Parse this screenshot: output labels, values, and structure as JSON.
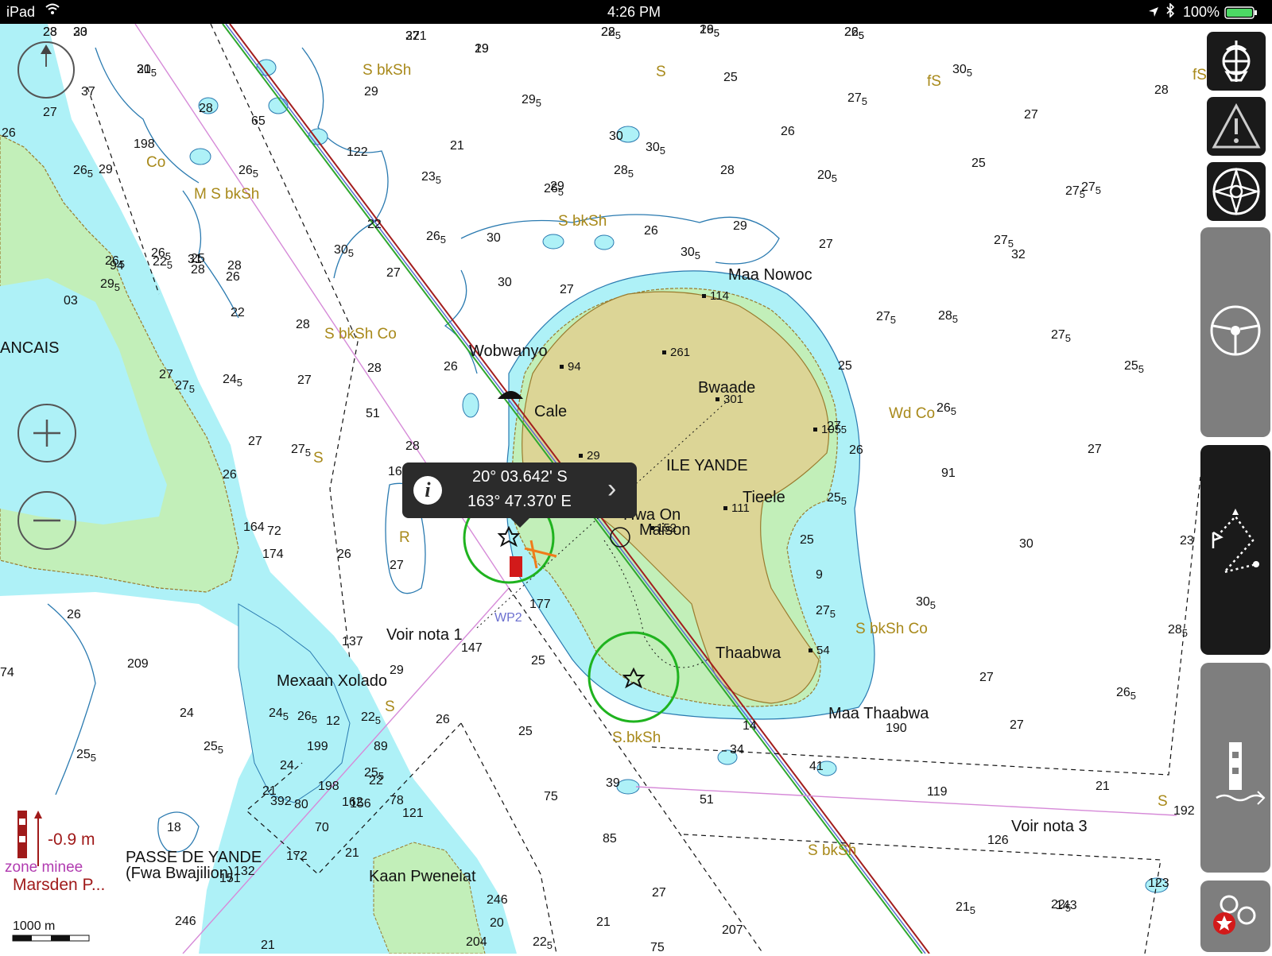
{
  "status_bar": {
    "device": "iPad",
    "time": "4:26 PM",
    "battery": "100%"
  },
  "colors": {
    "land": "#dcd596",
    "intertidal": "#c2efb9",
    "shallow": "#aef1f7",
    "deep": "#ffffff",
    "route_green": "#2ea82e",
    "route_red": "#a31d1d",
    "route_blue": "#5a6fd0",
    "seabed_text": "#a8891a"
  },
  "popup": {
    "latitude": "20° 03.642' S",
    "longitude": "163° 47.370' E"
  },
  "scale_label": "1000 m",
  "tide": {
    "value": "-0.9 m",
    "area": "zone minee",
    "station": "Marsden P..."
  },
  "place_names": {
    "ile_yande": "ILE YANDE",
    "bwaade": "Bwaade",
    "maa_nowoc": "Maa Nowoc",
    "wobwanyo": "Wobwanyo",
    "cale": "Cale",
    "hwa_on": "Hwa On",
    "maison": "Maison",
    "tieele": "Tieele",
    "thaabwa": "Thaabwa",
    "maa_thaabwa": "Maa Thaabwa",
    "mexaan": "Mexaan Xolado",
    "passe": "PASSE DE YANDE",
    "passe_sub": "(Fwa Bwajilion)",
    "kaan": "Kaan Pweneiat",
    "ancais": "ANCAIS",
    "voir1": "Voir nota 1",
    "voir3": "Voir nota 3",
    "wp2": "WP2"
  },
  "spot_heights": [
    "114",
    "261",
    "94",
    "301",
    "105",
    "29",
    "111",
    "152",
    "54"
  ],
  "seabed_labels": [
    "S bkSh",
    "S",
    "fS",
    "fS",
    "Co",
    "M S bkSh",
    "S bkSh",
    "S bkSh Co",
    "S",
    "Wd Co",
    "R",
    "S bkSh Co",
    "S",
    "S.bkSh",
    "S bkSh",
    "S"
  ],
  "soundings": [
    "28",
    "30",
    "27",
    "29",
    "285",
    "265",
    "265",
    "305",
    "29",
    "25",
    "305",
    "28",
    "295",
    "275",
    "28",
    "27",
    "25",
    "26",
    "27",
    "37",
    "65",
    "30",
    "305",
    "26",
    "198",
    "21",
    "29",
    "205",
    "275",
    "265",
    "29",
    "122",
    "265",
    "235",
    "28",
    "285",
    "265",
    "275",
    "265",
    "25",
    "31",
    "28",
    "305",
    "30",
    "22",
    "275",
    "265",
    "27",
    "225",
    "26",
    "28",
    "30",
    "265",
    "295",
    "94",
    "03",
    "22",
    "28",
    "27",
    "29",
    "26",
    "305",
    "27",
    "32",
    "275",
    "285",
    "275",
    "27",
    "275",
    "245",
    "27",
    "28",
    "26",
    "51",
    "27",
    "28",
    "275",
    "25",
    "265",
    "255",
    "275",
    "26",
    "255",
    "27",
    "26",
    "164",
    "72",
    "174",
    "26",
    "27",
    "169",
    "91",
    "25",
    "9",
    "275",
    "305",
    "30",
    "23",
    "285",
    "26",
    "137",
    "147",
    "177",
    "25",
    "27",
    "265",
    "27",
    "190",
    "209",
    "29",
    "24",
    "245",
    "265",
    "12",
    "225",
    "26",
    "89",
    "25",
    "34",
    "14",
    "41",
    "119",
    "21",
    "27",
    "192",
    "255",
    "255",
    "24",
    "199",
    "198",
    "255",
    "22",
    "21",
    "392",
    "80",
    "39",
    "51",
    "162",
    "156",
    "78",
    "121",
    "18",
    "70",
    "172",
    "21",
    "151",
    "132",
    "74",
    "126",
    "143",
    "85",
    "75",
    "246",
    "246",
    "20",
    "225",
    "21",
    "27",
    "207",
    "21",
    "204",
    "75",
    "123",
    "215",
    "225",
    "23",
    "23",
    "321",
    "19",
    "22",
    "195",
    "225",
    "21"
  ],
  "controls": {
    "compass_rose_label": "compass-rose",
    "zoom_in": "+",
    "zoom_out": "−"
  }
}
